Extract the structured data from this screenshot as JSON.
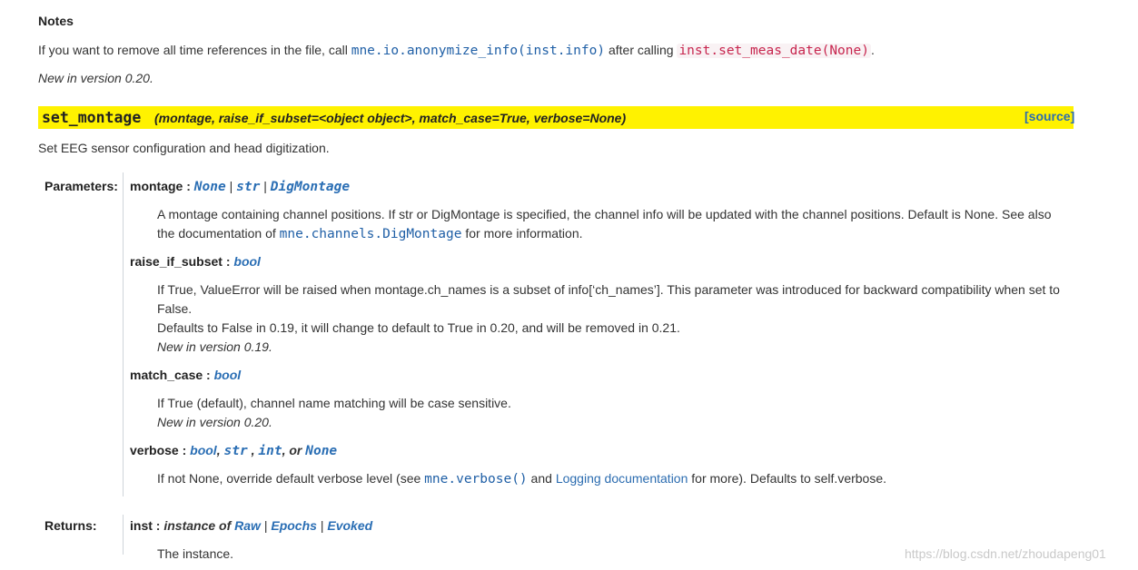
{
  "notes": {
    "heading": "Notes",
    "line_pre": "If you want to remove all time references in the file, call ",
    "line_code1": "mne.io.anonymize_info(inst.info)",
    "line_mid": " after calling ",
    "line_code2": "inst.set_meas_date(None)",
    "line_post": ".",
    "version": "New in version 0.20."
  },
  "signature": {
    "name": "set_montage",
    "params": "(montage, raise_if_subset=<object object>, match_case=True, verbose=None)",
    "source_label": "[source]",
    "highlight_color": "#fff200"
  },
  "description": "Set EEG sensor configuration and head digitization.",
  "parameters": {
    "label": "Parameters:",
    "items": [
      {
        "name": "montage",
        "sep": " : ",
        "types": [
          "None",
          "str",
          "DigMontage"
        ],
        "desc1": "A montage containing channel positions. If str or DigMontage is specified, the channel info will be updated with the channel positions. Default is None. See also",
        "desc2_pre": "the documentation of ",
        "desc2_code": "mne.channels.DigMontage",
        "desc2_post": " for more information."
      },
      {
        "name": "raise_if_subset",
        "sep": " : ",
        "type": "bool",
        "desc1": "If True, ValueError will be raised when montage.ch_names is a subset of info[‘ch_names’]. This parameter was introduced for backward compatibility when set to",
        "desc2": "False.",
        "desc3": "Defaults to False in 0.19, it will change to default to True in 0.20, and will be removed in 0.21.",
        "version": "New in version 0.19."
      },
      {
        "name": "match_case",
        "sep": " : ",
        "type": "bool",
        "desc1": "If True (default), channel name matching will be case sensitive.",
        "version": "New in version 0.20."
      },
      {
        "name": "verbose",
        "sep": " : ",
        "type1": "bool",
        "type2": "str",
        "type3": "int",
        "or_text": ", or ",
        "type4": "None",
        "desc_pre": "If not None, override default verbose level (see ",
        "desc_code": "mne.verbose()",
        "desc_mid": " and ",
        "desc_link": "Logging documentation",
        "desc_post": " for more). Defaults to self.verbose."
      }
    ]
  },
  "returns": {
    "label": "Returns:",
    "name": "inst",
    "sep": " : ",
    "instance_of": "instance of",
    "types": [
      "Raw",
      "Epochs",
      "Evoked"
    ],
    "desc": "The instance."
  },
  "watermark": "https://blog.csdn.net/zhoudapeng01"
}
